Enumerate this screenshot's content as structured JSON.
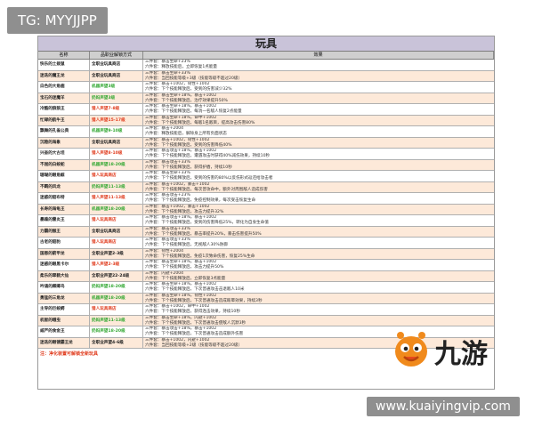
{
  "watermark_tg": "TG: MYYJJPP",
  "watermark_url": "www.kuaiyingvip.com",
  "logo_text": "九游",
  "table": {
    "title": "玩具",
    "headers": [
      "名称",
      "品职业解锁方式",
      "效果"
    ],
    "footer": "注：净化装置可解锁全新玩具",
    "rows": [
      {
        "name": "快乐的土拨鼠",
        "source": "全职业玩具商店",
        "color": "black",
        "effect1": "三件套：暴击生命+23%",
        "effect2": "六件套：释放技能后，立即恢复1点能量"
      },
      {
        "name": "迷迭的魔王龙",
        "source": "全职业玩具商店",
        "color": "black",
        "effect1": "三件套：暴击生命+33%",
        "effect2": "六件套：当回技能等级+3级（技能等级不超过20级）"
      },
      {
        "name": "白色的大角鹿",
        "source": "机器声望3级",
        "color": "green",
        "effect1": "三件套：暴击+1002，韧性+1002",
        "effect2": "六件套：下个技能释放后，受到的伤害减少32%"
      },
      {
        "name": "宝石的迷魔羊",
        "source": "奶妈声望3级",
        "color": "green",
        "effect1": "三件套：暴击生命+18%，暴击+1002",
        "effect2": "六件套：下个技能释放后，治疗效果提升50%"
      },
      {
        "name": "冷酷的狼狼王",
        "source": "猎人声望7-8级",
        "color": "red",
        "effect1": "三件套：暴击生命+18%，暴击+1002",
        "effect2": "六件套：下个技能释放后，每消一名敌人恢复2点能量"
      },
      {
        "name": "忙碌的航牛王",
        "source": "猎人声望15-17级",
        "color": "red",
        "effect1": "三件套：暴击生命+18%，命中+1002",
        "effect2": "六件套：下个技能释放后，每敌1名敌目，提高攻击伤害80%"
      },
      {
        "name": "飘舞的孔雀公典",
        "source": "机器声望9-10级",
        "color": "green",
        "effect1": "三件套：暴击+2004",
        "effect2": "六件套：释放技能后，解除身上所有负面状态"
      },
      {
        "name": "沉稳的海象",
        "source": "全职业玩具商店",
        "color": "black",
        "effect1": "三件套：暴击+1002，韧性+1002",
        "effect2": "六件套：下个技能释放后，受到的伤害降低40%"
      },
      {
        "name": "兴奋的大古坦",
        "source": "猎人声望8-10级",
        "color": "red",
        "effect1": "三件套：暴击攻击+18%，暴击+1002",
        "effect2": "六件套：下个技能释放后，遭遇攻击时获得40%减伤效果，持续10秒"
      },
      {
        "name": "不屈的白蛟蛇",
        "source": "机器声望18-20级",
        "color": "green",
        "effect1": "三件套：暴击攻击+33%",
        "effect2": "六件套：下个技能释放后，获得护盾，持续10秒"
      },
      {
        "name": "珊瑚的眼角鲸",
        "source": "猎人玩具商店",
        "color": "red",
        "effect1": "三件套：暴击生命+33%",
        "effect2": "六件套：下个技能释放后，受到的伤害的80%以反伤形式返还给攻击者"
      },
      {
        "name": "不羁的风龙",
        "source": "奶妈声望11-13级",
        "color": "green",
        "effect1": "三件套：暴击+1002，暴击+1002",
        "effect2": "六件套：下个技能释放后，每次普攻命中，额外对周围敌人造成伤害"
      },
      {
        "name": "迷惑的貂布特",
        "source": "猎人声望11-13级",
        "color": "red",
        "effect1": "三件套：暴击攻击+23%",
        "effect2": "六件套：下个技能释放后，免疫控制效果，每次受击恢复生命"
      },
      {
        "name": "长寿的海龟王",
        "source": "机器声望18-20级",
        "color": "green",
        "effect1": "三件套：暴击+1002，暴击+1002",
        "effect2": "六件套：下个技能释放后，攻击力提升32%"
      },
      {
        "name": "暴躁的雷炎王",
        "source": "猎人玩具商店",
        "color": "red",
        "effect1": "三件套：暴击攻击+18%，暴击+1002",
        "effect2": "六件套：下个技能释放后，受到的伤害降低25%，转化为自身生命值"
      },
      {
        "name": "力霸的猴王",
        "source": "全职业玩具商店",
        "color": "black",
        "effect1": "三件套：暴击攻击+33%",
        "effect2": "六件套：下个技能释放后，暴击率提升20%，暴击伤害提升50%"
      },
      {
        "name": "古老的貂豹",
        "source": "猎人玩具商店",
        "color": "red",
        "effect1": "三件套：暴击攻击+33%",
        "effect2": "六件套：下个技能释放后，无视敌人30%防御"
      },
      {
        "name": "国恩的箭甲龙",
        "source": "全职业声望2-3级",
        "color": "black",
        "effect1": "三件套：韧性+2004",
        "effect2": "六件套：下个技能释放后，免疫1次致命伤害，恢复25%生命"
      },
      {
        "name": "迷惑的眼黑卡尔",
        "source": "猎人声望2-3级",
        "color": "red",
        "effect1": "三件套：暴击生命+18%，暴击+1002",
        "effect2": "六件套：下个技能释放后，攻击力提升50%"
      },
      {
        "name": "柔乐的翠鹤大仙",
        "source": "全职业声望22-24级",
        "color": "black",
        "effect1": "三件套：闪避+2004",
        "effect2": "六件套：下个技能释放后，立即恢复3点能量"
      },
      {
        "name": "吟诵的卿卿鸟",
        "source": "奶妈声望18-20级",
        "color": "green",
        "effect1": "三件套：暴击生命+18%，暴击+1002",
        "effect2": "六件套：下个技能释放后，下次普通攻击击退敌人10米"
      },
      {
        "name": "勇猛的三角龙",
        "source": "机器声望18-20级",
        "color": "green",
        "effect1": "三件套：暴击生命+18%，韧性+1002",
        "effect2": "六件套：下个技能释放后，下次普通攻击造成眩晕效果，持续3秒"
      },
      {
        "name": "主导的巨蛟鳄",
        "source": "猎人玩具商店",
        "color": "red",
        "effect1": "三件套：暴击+1002，命中+1002",
        "effect2": "六件套：下个技能释放后，获得连击效果，持续10秒"
      },
      {
        "name": "机智的蛾虫",
        "source": "奶妈声望11-13级",
        "color": "green",
        "effect1": "三件套：暴击生命+18%，闪避+1002",
        "effect2": "六件套：下个技能释放后，下次普通攻击使敌人沉默3秒"
      },
      {
        "name": "威严的食金王",
        "source": "奶妈声望18-20级",
        "color": "green",
        "effect1": "三件套：暴击攻击+18%，暴击+1002",
        "effect2": "六件套：下个技能释放后，下次普通攻击造成额外伤害"
      },
      {
        "name": "迷迭的眼镜霸王龙",
        "source": "全职业声望4-6级",
        "color": "black",
        "effect1": "三件套：暴击+1002，闪避+1002",
        "effect2": "六件套：当回技能等级+2级（技能等级不超过20级）"
      }
    ]
  }
}
